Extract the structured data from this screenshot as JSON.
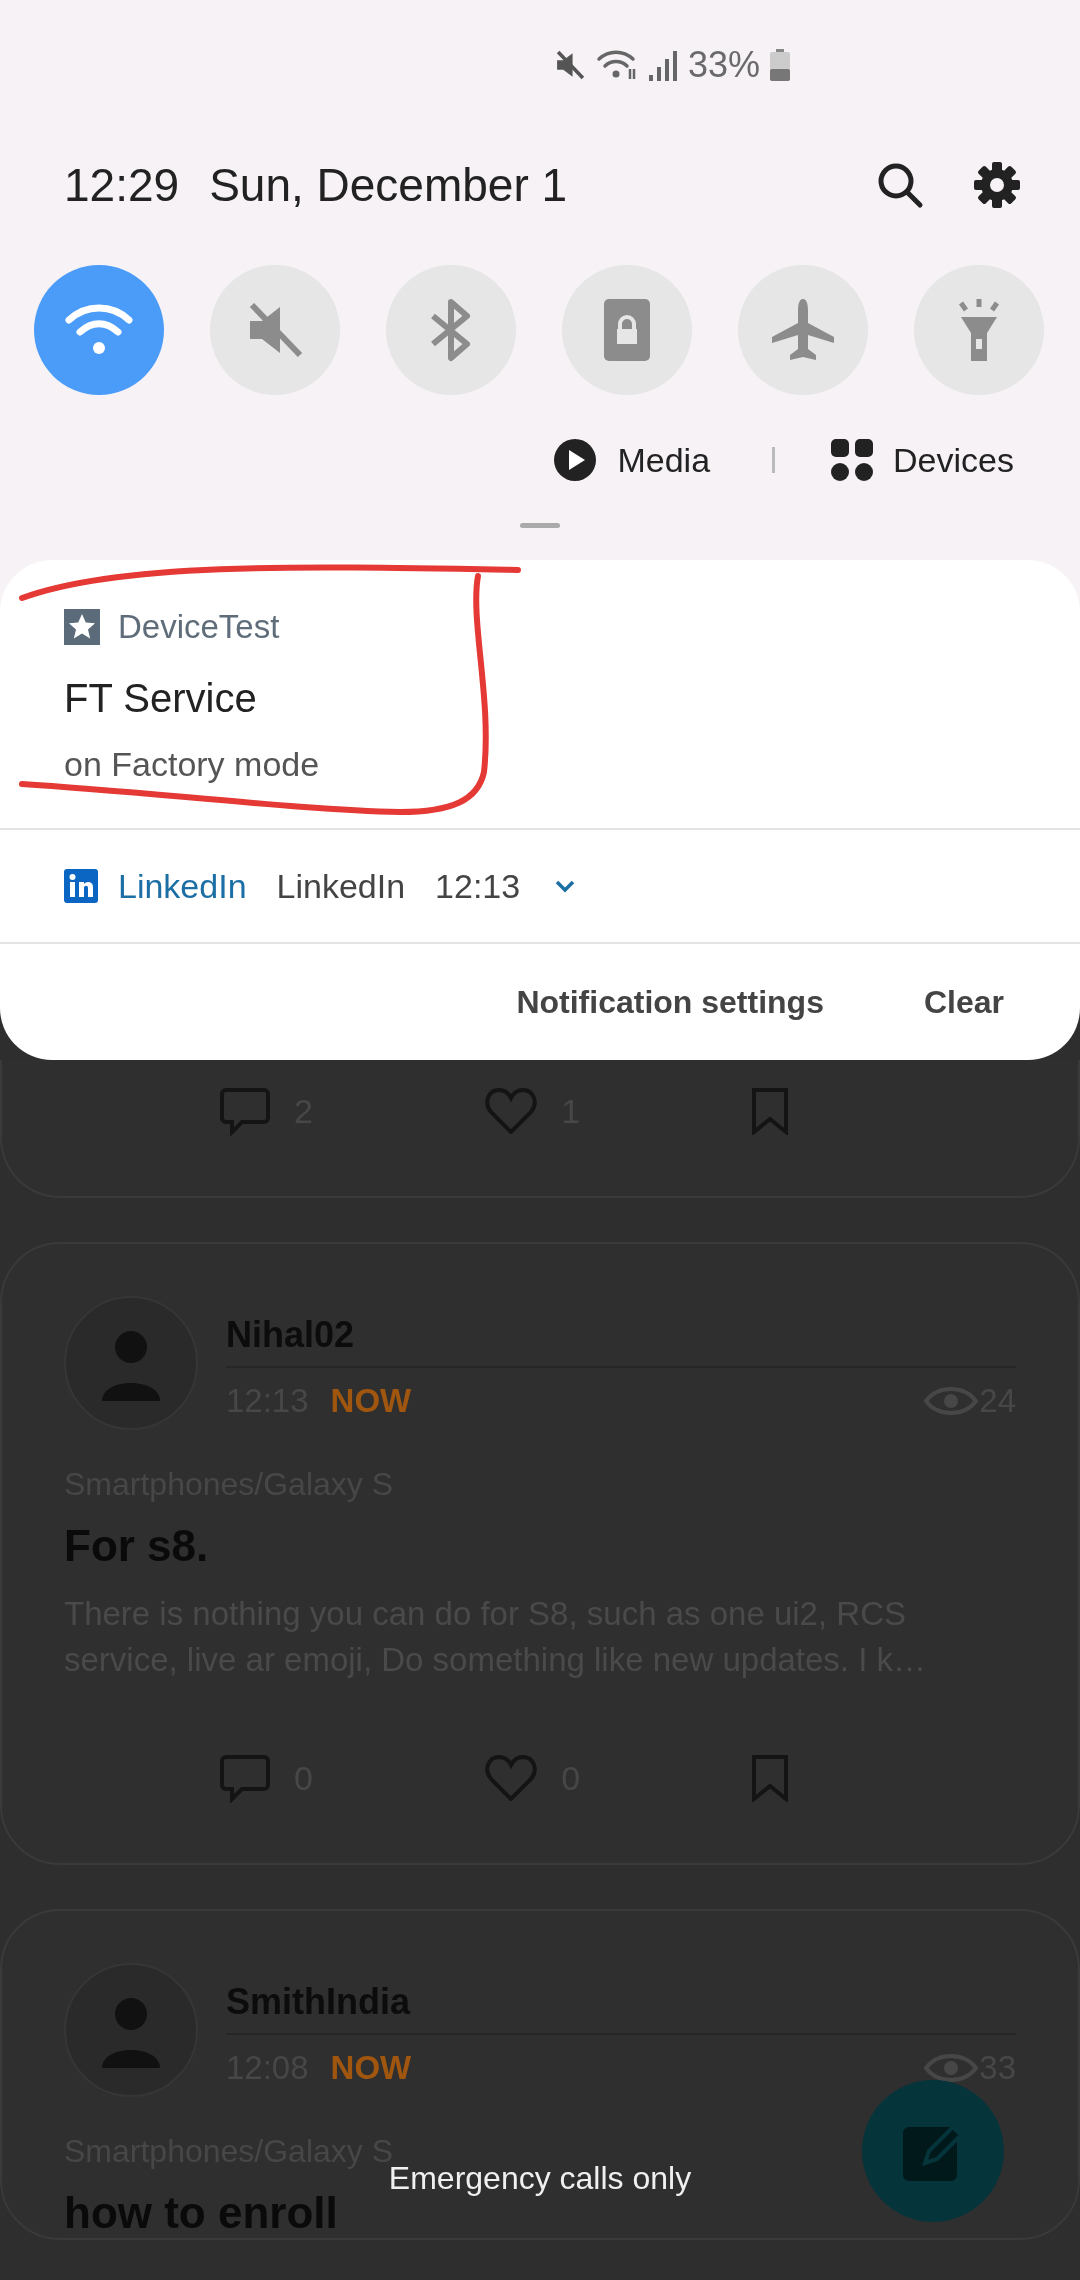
{
  "status_bar": {
    "battery_text": "33%"
  },
  "header": {
    "time": "12:29",
    "date": "Sun, December 1"
  },
  "quick_toggles": [
    {
      "kind": "wifi",
      "on": true
    },
    {
      "kind": "sound",
      "on": false
    },
    {
      "kind": "bluetooth",
      "on": false
    },
    {
      "kind": "lock",
      "on": false
    },
    {
      "kind": "airplane",
      "on": false
    },
    {
      "kind": "flashlight",
      "on": false
    }
  ],
  "media_row": {
    "media": "Media",
    "devices": "Devices"
  },
  "notifications": [
    {
      "kind": "expanded",
      "app": "DeviceTest",
      "title": "FT Service",
      "text": "on Factory mode"
    },
    {
      "kind": "collapsed",
      "app": "LinkedIn",
      "title": "LinkedIn",
      "time": "12:13"
    }
  ],
  "notification_actions": [
    "Notification settings",
    "Clear"
  ],
  "feed": {
    "posts": [
      {
        "comments": "2",
        "likes": "1"
      },
      {
        "author": "Nihal02",
        "time": "12:13",
        "badge": "NOW",
        "views": "24",
        "category": "Smartphones/Galaxy S",
        "title": "For s8.",
        "excerpt": "There is nothing you can do for S8, such as one ui2, RCS service, live ar emoji, Do something like new updates. I k…",
        "comments": "0",
        "likes": "0"
      },
      {
        "author": "SmithIndia",
        "time": "12:08",
        "badge": "NOW",
        "views": "33",
        "category": "Smartphones/Galaxy S",
        "title": "how to enroll"
      }
    ]
  },
  "emergency_text": "Emergency calls only"
}
